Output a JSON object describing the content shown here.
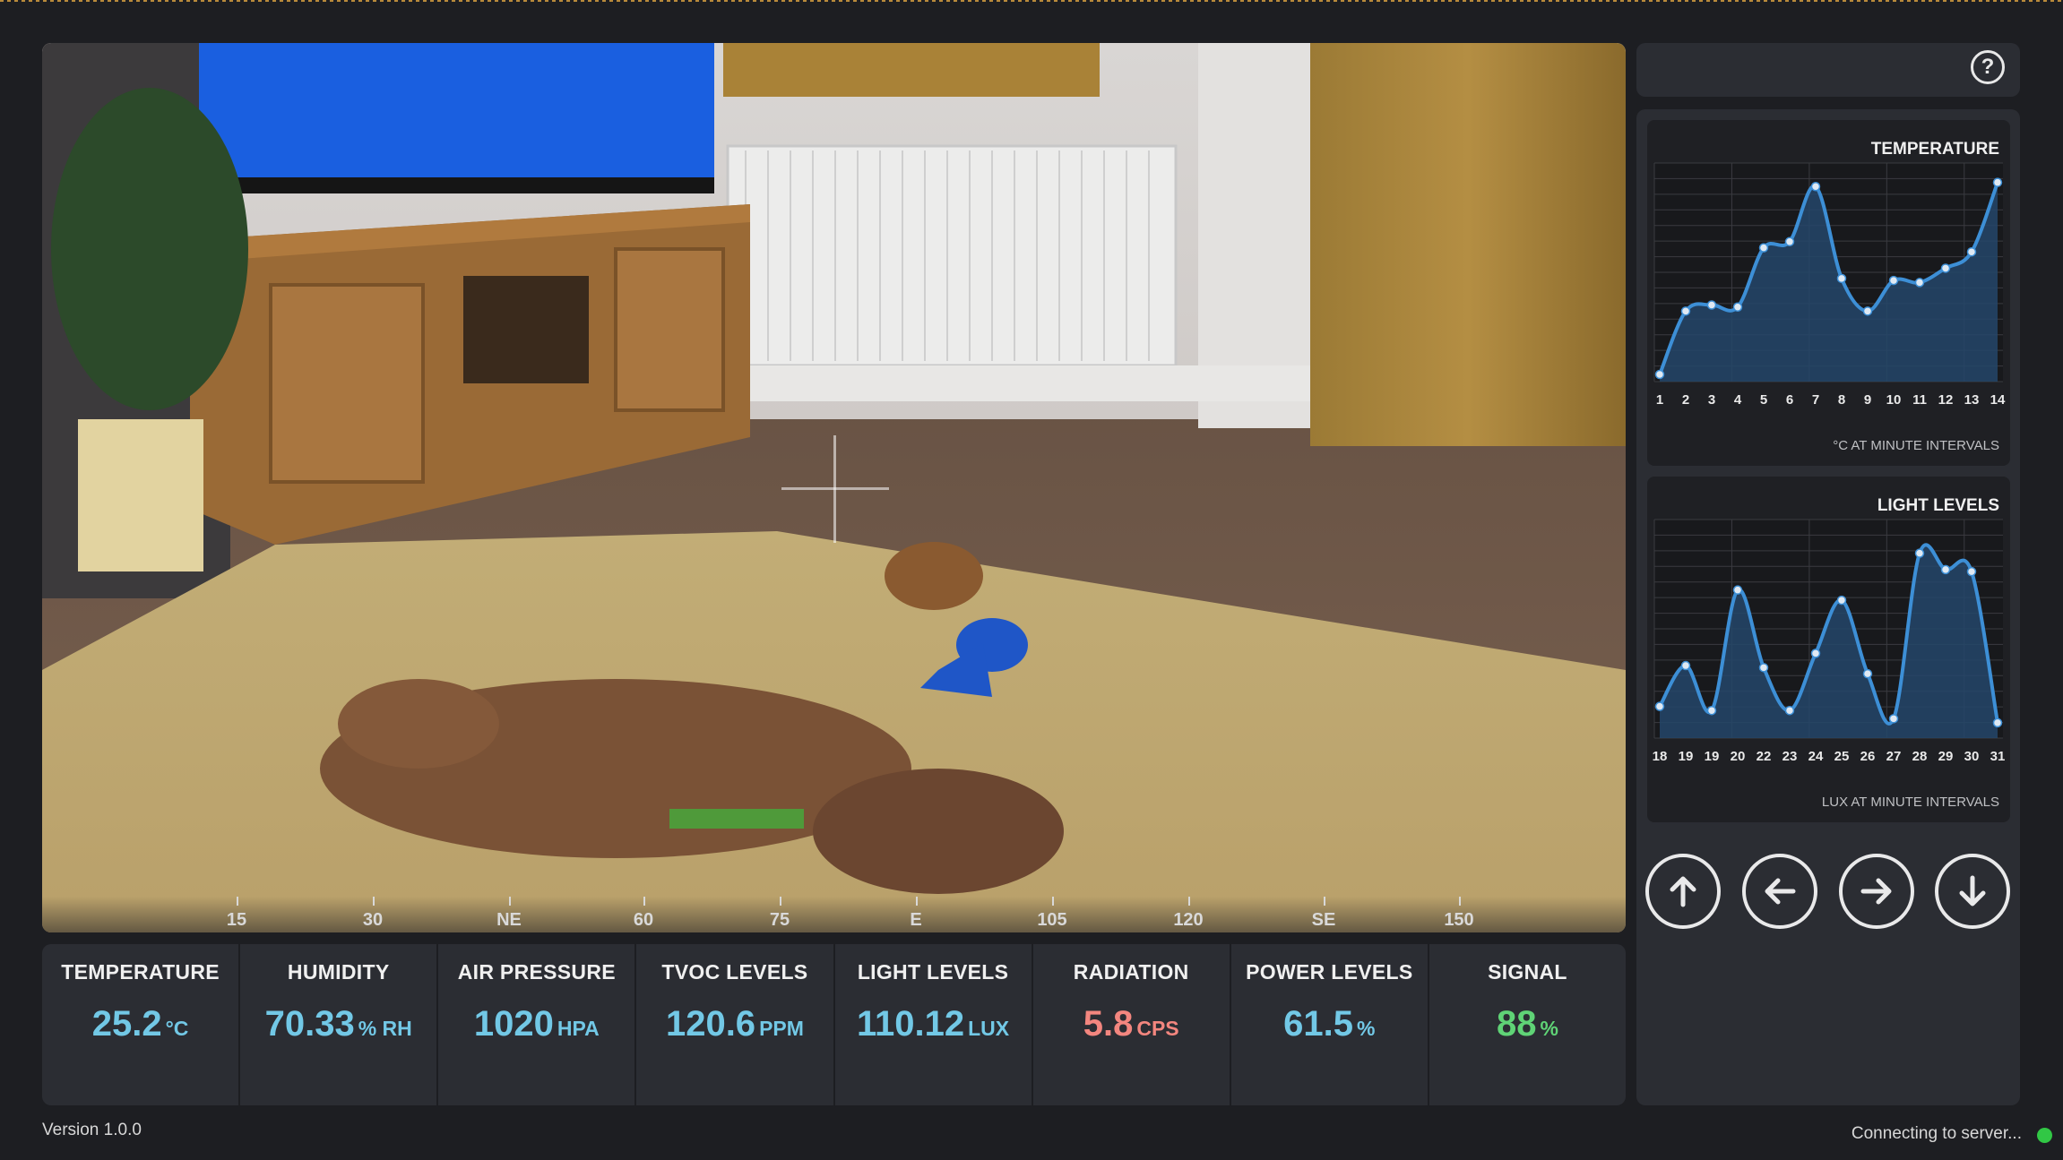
{
  "app": {
    "version": "Version 1.0.0",
    "status": "Connecting to server...",
    "status_color": "#31c745"
  },
  "compass": [
    {
      "label": "15",
      "frac": 0.123
    },
    {
      "label": "30",
      "frac": 0.209
    },
    {
      "label": "NE",
      "frac": 0.295
    },
    {
      "label": "60",
      "frac": 0.38
    },
    {
      "label": "75",
      "frac": 0.466
    },
    {
      "label": "E",
      "frac": 0.552
    },
    {
      "label": "105",
      "frac": 0.638
    },
    {
      "label": "120",
      "frac": 0.724
    },
    {
      "label": "SE",
      "frac": 0.809
    },
    {
      "label": "150",
      "frac": 0.895
    }
  ],
  "metrics": [
    {
      "label": "TEMPERATURE",
      "value": "25.2",
      "unit": "°C",
      "color": "#72c8e6"
    },
    {
      "label": "HUMIDITY",
      "value": "70.33",
      "unit": "% RH",
      "color": "#72c8e6"
    },
    {
      "label": "AIR PRESSURE",
      "value": "1020",
      "unit": "HPA",
      "color": "#72c8e6"
    },
    {
      "label": "TVOC LEVELS",
      "value": "120.6",
      "unit": "PPM",
      "color": "#72c8e6"
    },
    {
      "label": "LIGHT LEVELS",
      "value": "110.12",
      "unit": "LUX",
      "color": "#72c8e6"
    },
    {
      "label": "RADIATION",
      "value": "5.8",
      "unit": "CPS",
      "color": "#f3867f"
    },
    {
      "label": "POWER LEVELS",
      "value": "61.5",
      "unit": "%",
      "color": "#72c8e6"
    },
    {
      "label": "SIGNAL",
      "value": "88",
      "unit": "%",
      "color": "#5fd376"
    }
  ],
  "help_label": "?",
  "controls": [
    "up-arrow-icon",
    "left-arrow-icon",
    "right-arrow-icon",
    "down-arrow-icon"
  ],
  "chart_data": [
    {
      "type": "area",
      "title": "TEMPERATURE",
      "subtitle": "°C AT MINUTE INTERVALS",
      "x": [
        "1",
        "2",
        "3",
        "4",
        "5",
        "6",
        "7",
        "8",
        "9",
        "10",
        "11",
        "12",
        "13",
        "14"
      ],
      "values": [
        0.0,
        0.31,
        0.34,
        0.33,
        0.62,
        0.65,
        0.92,
        0.47,
        0.31,
        0.46,
        0.45,
        0.52,
        0.6,
        0.94
      ],
      "ylim": [
        0,
        1
      ],
      "grid": true,
      "line_color": "#3d8fd6",
      "fill_color": "#24466a"
    },
    {
      "type": "area",
      "title": "LIGHT LEVELS",
      "subtitle": "LUX AT MINUTE INTERVALS",
      "x": [
        "18",
        "19",
        "19",
        "20",
        "22",
        "23",
        "24",
        "25",
        "26",
        "27",
        "28",
        "29",
        "30",
        "31"
      ],
      "values": [
        0.12,
        0.32,
        0.1,
        0.69,
        0.31,
        0.1,
        0.38,
        0.64,
        0.28,
        0.06,
        0.87,
        0.79,
        0.78,
        0.04
      ],
      "ylim": [
        0,
        1
      ],
      "grid": true,
      "line_color": "#3d8fd6",
      "fill_color": "#24466a"
    }
  ]
}
